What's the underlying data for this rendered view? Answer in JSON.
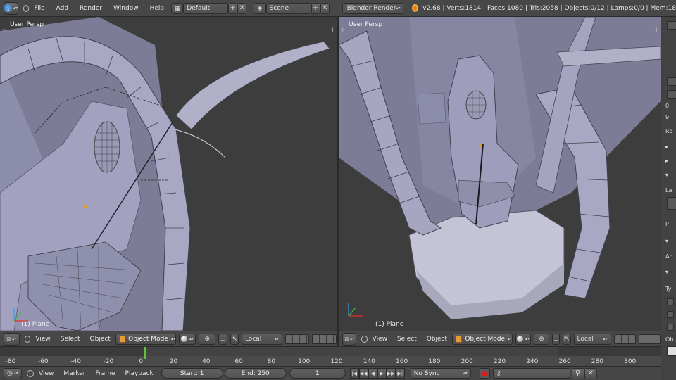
{
  "top_header": {
    "menus": [
      "File",
      "Add",
      "Render",
      "Window",
      "Help"
    ],
    "layout_name": "Default",
    "scene_name": "Scene",
    "render_engine": "Blender Render",
    "stats": "v2.68 | Verts:1814 | Faces:1080 | Tris:2058 | Objects:0/12 | Lamps:0/0 | Mem:18"
  },
  "viewports": [
    {
      "label": "User Persp",
      "object": "(1) Plane"
    },
    {
      "label": "User Persp",
      "object": "(1) Plane"
    }
  ],
  "view_header": {
    "menus": [
      "View",
      "Select",
      "Object"
    ],
    "mode": "Object Mode",
    "pivot": "Local"
  },
  "timeline": {
    "ticks": [
      "-80",
      "-60",
      "-40",
      "-20",
      "0",
      "20",
      "40",
      "60",
      "80",
      "100",
      "120",
      "140",
      "160",
      "180",
      "200",
      "220",
      "240",
      "260",
      "280",
      "300"
    ],
    "current_frame_mark": 0
  },
  "timeline_header": {
    "menus": [
      "View",
      "Marker",
      "Frame",
      "Playback"
    ],
    "start": "Start: 1",
    "end": "End: 250",
    "current": "1",
    "sync": "No Sync"
  },
  "right_panel": {
    "labels": [
      "0",
      "9",
      "Ro",
      "La",
      "Ac",
      "Ty",
      "Ob"
    ],
    "button": "P"
  },
  "colors": {
    "viewport_bg": "#3d3d3d",
    "mesh_face": "#9a9ab8",
    "header_bg": "#474747",
    "frame_cursor": "#5ec33a"
  }
}
